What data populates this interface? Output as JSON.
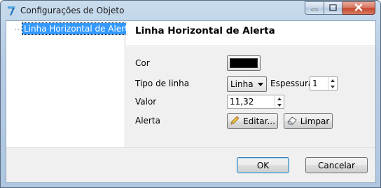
{
  "window": {
    "title": "Configurações de Objeto"
  },
  "tree": {
    "items": [
      {
        "label": "Linha Horizontal de Alerta",
        "selected": true
      }
    ]
  },
  "panel": {
    "title": "Linha Horizontal de Alerta",
    "cor_label": "Cor",
    "cor_value": "#000000",
    "tipo_label": "Tipo de linha",
    "tipo_value": "Linha",
    "espessura_label": "Espessura",
    "espessura_value": "1",
    "valor_label": "Valor",
    "valor_value": "11,32",
    "alerta_label": "Alerta",
    "editar_label": "Editar...",
    "limpar_label": "Limpar"
  },
  "footer": {
    "ok_label": "OK",
    "cancel_label": "Cancelar"
  },
  "icons": {
    "app": "app-logo-icon",
    "minimize": "minimize-icon",
    "maximize": "maximize-icon",
    "close": "close-icon",
    "edit": "pencil-icon",
    "clear": "eraser-icon"
  }
}
